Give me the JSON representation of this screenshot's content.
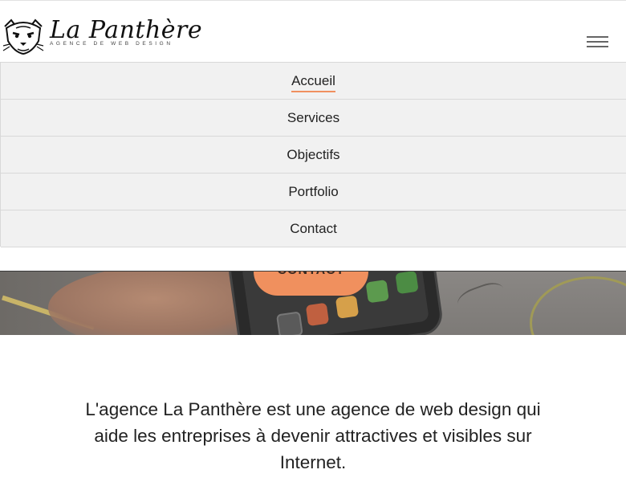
{
  "brand": {
    "name": "La Panthère",
    "tagline": "AGENCE DE WEB DESIGN",
    "logo_icon": "panther-head-icon"
  },
  "header": {
    "menu_icon": "hamburger-menu-icon"
  },
  "nav": {
    "items": [
      {
        "label": "Accueil",
        "active": true
      },
      {
        "label": "Services",
        "active": false
      },
      {
        "label": "Objectifs",
        "active": false
      },
      {
        "label": "Portfolio",
        "active": false
      },
      {
        "label": "Contact",
        "active": false
      }
    ]
  },
  "hero": {
    "cta_label": "CONTACT"
  },
  "intro": {
    "text": "L'agence La Panthère est une agence de web design qui aide les entreprises à devenir attractives et visibles sur Internet."
  },
  "colors": {
    "accent": "#f0905e",
    "nav_background": "#f1f1f1",
    "text": "#222222"
  }
}
